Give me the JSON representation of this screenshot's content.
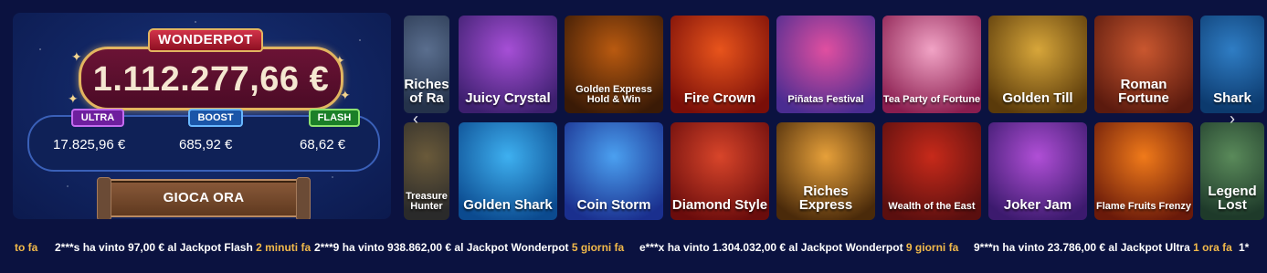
{
  "jackpot": {
    "title": "WONDERPOT",
    "main_value": "1.112.277,66 €",
    "tiers": [
      {
        "name": "ULTRA",
        "value": "17.825,96 €"
      },
      {
        "name": "BOOST",
        "value": "685,92 €"
      },
      {
        "name": "FLASH",
        "value": "68,62 €"
      }
    ],
    "cta_label": "GIOCA ORA"
  },
  "games": [
    {
      "title": "Juicy Crystal",
      "colors": [
        "#3c1f6e",
        "#a64fd6"
      ]
    },
    {
      "title": "Golden Express Hold & Win",
      "colors": [
        "#3a1a06",
        "#b95a10"
      ]
    },
    {
      "title": "Fire Crown",
      "colors": [
        "#7a0e08",
        "#e8541c"
      ]
    },
    {
      "title": "Piñatas Festival",
      "colors": [
        "#4a2c91",
        "#e04fa0"
      ]
    },
    {
      "title": "Tea Party of Fortune",
      "colors": [
        "#8a1d4f",
        "#f1a3c5"
      ]
    },
    {
      "title": "Golden Till",
      "colors": [
        "#5a3a0a",
        "#d7a63a"
      ]
    },
    {
      "title": "Roman Fortune",
      "colors": [
        "#5b1a0e",
        "#c9572f"
      ]
    },
    {
      "title": "Shark",
      "colors": [
        "#0c3a6e",
        "#2f7dc4"
      ]
    },
    {
      "title": "Golden Shark",
      "colors": [
        "#0b4a8f",
        "#3eb0f0"
      ]
    },
    {
      "title": "Coin Storm",
      "colors": [
        "#1a2f8e",
        "#4ba0f0"
      ]
    },
    {
      "title": "Diamond Style",
      "colors": [
        "#6a0c0c",
        "#d8452a"
      ]
    },
    {
      "title": "Riches Express",
      "colors": [
        "#4a2a0a",
        "#e6a03a"
      ]
    },
    {
      "title": "Wealth of the East",
      "colors": [
        "#5a0f0f",
        "#c72a1a"
      ]
    },
    {
      "title": "Joker Jam",
      "colors": [
        "#3c1a6e",
        "#b04fd6"
      ]
    },
    {
      "title": "Flame Fruits Frenzy",
      "colors": [
        "#6a1a0a",
        "#f07a1a"
      ]
    },
    {
      "title": "Legend Lost",
      "colors": [
        "#1e3a2a",
        "#5a8a5a"
      ]
    }
  ],
  "partial_games": [
    {
      "title": "Riches of Ra",
      "colors": [
        "#24324a",
        "#5a6e8e"
      ]
    },
    {
      "title": "Treasure Hunter",
      "colors": [
        "#2a2a2a",
        "#6a5a3a"
      ]
    }
  ],
  "nav": {
    "prev": "‹",
    "next": "›"
  },
  "ticker": [
    {
      "text": "to fa",
      "time": ""
    },
    {
      "text": "2***s ha vinto 97,00 € al Jackpot Flash ",
      "time": "2 minuti fa"
    },
    {
      "text": "2***9 ha vinto 938.862,00 € al Jackpot Wonderpot ",
      "time": "5 giorni fa"
    },
    {
      "text": "e***x ha vinto 1.304.032,00 € al Jackpot Wonderpot ",
      "time": "9 giorni fa"
    },
    {
      "text": "9***n ha vinto 23.786,00 € al Jackpot Ultra ",
      "time": "1 ora fa"
    },
    {
      "text": "1*",
      "time": ""
    }
  ]
}
